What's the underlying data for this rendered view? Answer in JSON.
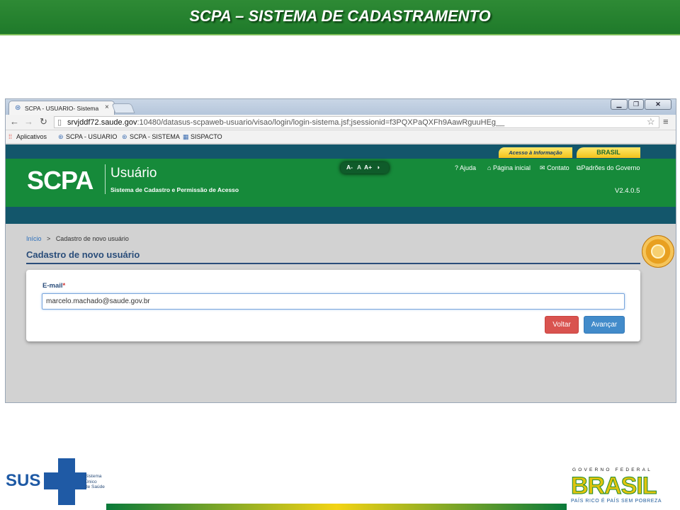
{
  "slide": {
    "title": "SCPA – SISTEMA DE CADASTRAMENTO"
  },
  "browser": {
    "tab_title": "SCPA - USUARIO- Sistema",
    "tab_close": "×",
    "url_host": "srvjddf72.saude.gov",
    "url_path": ":10480/datasus-scpaweb-usuario/visao/login/login-sistema.jsf;jsessionid=f3PQXPaQXFh9AawRguuHEg__",
    "bookmarks": [
      "Aplicativos",
      "SCPA - USUARIO",
      "SCPA - SISTEMA",
      "SISPACTO"
    ]
  },
  "gov_bar": {
    "acesso": "Acesso à Informação",
    "brasil": "BRASIL"
  },
  "header": {
    "logo": "SCPA",
    "module": "Usuário",
    "subtitle": "Sistema de Cadastro e Permissão de Acesso",
    "font_controls": [
      "A-",
      "A",
      "A+"
    ],
    "links": [
      "Ajuda",
      "Página inicial",
      "Contato",
      "Padrões do Governo"
    ],
    "version": "V2.4.0.5"
  },
  "breadcrumb": {
    "home": "Início",
    "separator": ">",
    "current": "Cadastro de novo usuário"
  },
  "main": {
    "title": "Cadastro de novo usuário",
    "email_label": "E-mail",
    "required_mark": "*",
    "email_value": "marcelo.machado@saude.gov.br",
    "voltar_label": "Voltar",
    "avancar_label": "Avançar"
  },
  "footer": {
    "sus": "SUS",
    "sus_tagline": [
      "Sistema",
      "Único",
      "de Saúde"
    ],
    "gov_caption": "GOVERNO FEDERAL",
    "brasil": "BRASIL",
    "brasil_slogan": "PAÍS RICO É PAÍS SEM POBREZA"
  },
  "colors": {
    "banner_green": "#1f7a2a",
    "header_green": "#168a3a",
    "gov_blue": "#13566b",
    "btn_voltar": "#d9534f",
    "btn_avancar": "#428bca"
  }
}
